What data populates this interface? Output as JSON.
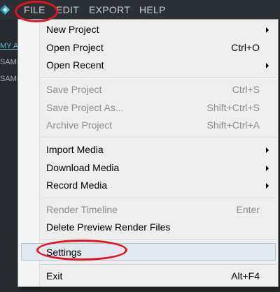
{
  "menubar": {
    "items": [
      "FILE",
      "EDIT",
      "EXPORT",
      "HELP"
    ],
    "highlighted": "FILE",
    "logo_icon": "filmora-diamond-logo-icon"
  },
  "background": {
    "panel_link": "MY A",
    "panel_items": [
      "SAMP",
      "SAMP"
    ]
  },
  "file_menu": {
    "groups": [
      [
        {
          "label": "New Project",
          "shortcut": "",
          "submenu": true,
          "enabled": true
        },
        {
          "label": "Open Project",
          "shortcut": "Ctrl+O",
          "submenu": false,
          "enabled": true
        },
        {
          "label": "Open Recent",
          "shortcut": "",
          "submenu": true,
          "enabled": true
        }
      ],
      [
        {
          "label": "Save Project",
          "shortcut": "Ctrl+S",
          "submenu": false,
          "enabled": false
        },
        {
          "label": "Save Project As...",
          "shortcut": "Shift+Ctrl+S",
          "submenu": false,
          "enabled": false
        },
        {
          "label": "Archive Project",
          "shortcut": "Shift+Ctrl+A",
          "submenu": false,
          "enabled": false
        }
      ],
      [
        {
          "label": "Import Media",
          "shortcut": "",
          "submenu": true,
          "enabled": true
        },
        {
          "label": "Download Media",
          "shortcut": "",
          "submenu": true,
          "enabled": true
        },
        {
          "label": "Record Media",
          "shortcut": "",
          "submenu": true,
          "enabled": true
        }
      ],
      [
        {
          "label": "Render Timeline",
          "shortcut": "Enter",
          "submenu": false,
          "enabled": false
        },
        {
          "label": "Delete Preview Render Files",
          "shortcut": "",
          "submenu": false,
          "enabled": true
        }
      ],
      [
        {
          "label": "Settings",
          "shortcut": "",
          "submenu": false,
          "enabled": true,
          "highlighted": true
        }
      ],
      [
        {
          "label": "Exit",
          "shortcut": "Alt+F4",
          "submenu": false,
          "enabled": true
        }
      ]
    ]
  },
  "annotation_color": "#e0141f",
  "colors": {
    "menubar_bg": "#2c3136",
    "menu_bg": "#eeeeee",
    "disabled_text": "#8d8d8d",
    "highlight_bg": "#e2e8ef"
  }
}
